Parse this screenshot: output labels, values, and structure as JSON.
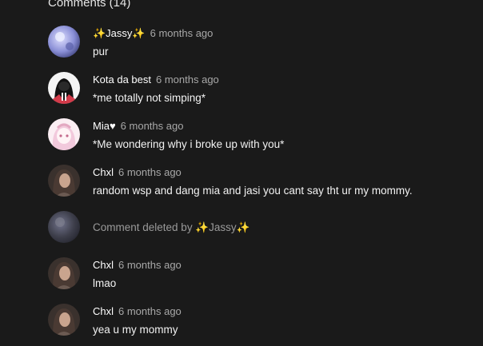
{
  "section": {
    "title": "Comments (14)"
  },
  "comments": [
    {
      "username": "✨Jassy✨",
      "time": "6 months ago",
      "text": "pur",
      "avatar_icon": "moon-avatar-icon",
      "avatar_color": "#8a8fd6"
    },
    {
      "username": "Kota da best",
      "time": "6 months ago",
      "text": "*me totally not simping*",
      "avatar_icon": "hooded-figure-avatar-icon",
      "avatar_color": "#d33b4a"
    },
    {
      "username": "Mia♥",
      "time": "6 months ago",
      "text": "*Me wondering why i broke up with you*",
      "avatar_icon": "anime-girl-avatar-icon",
      "avatar_color": "#f2c9dc"
    },
    {
      "username": "Chxl",
      "time": "6 months ago",
      "text": "random wsp and dang mia and jasi you cant say tht ur my mommy.",
      "avatar_icon": "person-avatar-icon",
      "avatar_color": "#6b5a52"
    },
    {
      "deleted": true,
      "text": "Comment deleted by ✨Jassy✨",
      "avatar_icon": "faded-avatar-icon",
      "avatar_color": "#5b5d73"
    },
    {
      "username": "Chxl",
      "time": "6 months ago",
      "text": "lmao",
      "avatar_icon": "person-avatar-icon",
      "avatar_color": "#6b5a52"
    },
    {
      "username": "Chxl",
      "time": "6 months ago",
      "text": "yea u my mommy",
      "avatar_icon": "person-avatar-icon",
      "avatar_color": "#6b5a52"
    }
  ]
}
